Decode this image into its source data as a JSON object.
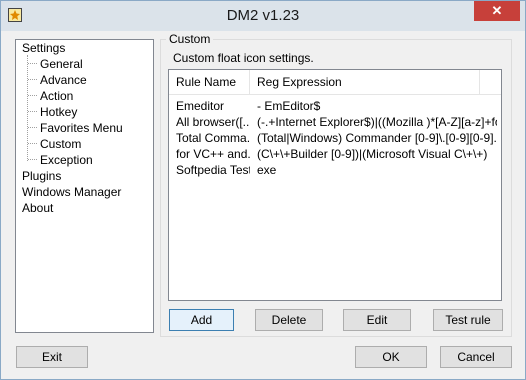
{
  "window": {
    "title": "DM2 v1.23",
    "close_glyph": "✕"
  },
  "tree": {
    "items": [
      {
        "label": "Settings",
        "level": 0
      },
      {
        "label": "General",
        "level": 1
      },
      {
        "label": "Advance",
        "level": 1
      },
      {
        "label": "Action",
        "level": 1
      },
      {
        "label": "Hotkey",
        "level": 1
      },
      {
        "label": "Favorites Menu",
        "level": 1
      },
      {
        "label": "Custom",
        "level": 1
      },
      {
        "label": "Exception",
        "level": 1
      },
      {
        "label": "Plugins",
        "level": 0
      },
      {
        "label": "Windows Manager",
        "level": 0
      },
      {
        "label": "About",
        "level": 0
      }
    ]
  },
  "custom": {
    "group_label": "Custom",
    "description": "Custom float icon settings.",
    "columns": [
      "Rule Name",
      "Reg Expression"
    ],
    "rows": [
      [
        "Emeditor",
        "- EmEditor$"
      ],
      [
        "All browser([...",
        "(-.+Internet Explorer$)|((Mozilla )*[A-Z][a-z]+fo..."
      ],
      [
        "Total Comma...",
        "(Total|Windows) Commander [0-9]\\.[0-9][0-9]..."
      ],
      [
        "for VC++ and...",
        "(C\\+\\+Builder [0-9])|(Microsoft Visual C\\+\\+)"
      ],
      [
        "Softpedia Test",
        "exe"
      ]
    ],
    "buttons": {
      "add": "Add",
      "delete": "Delete",
      "edit": "Edit",
      "test": "Test rule"
    }
  },
  "footer": {
    "exit": "Exit",
    "ok": "OK",
    "cancel": "Cancel"
  }
}
